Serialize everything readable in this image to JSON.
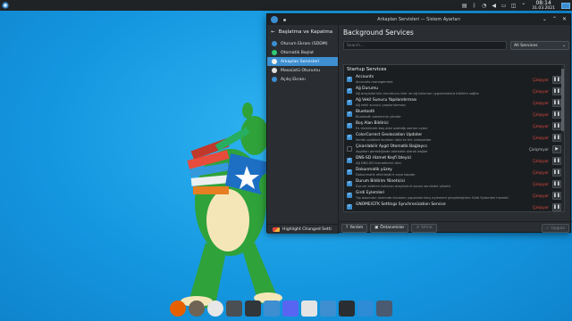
{
  "window": {
    "title": "Arkaplan Servisleri — Sistem Ayarları"
  },
  "sidebar": {
    "header": "Başlatma ve Kapatma",
    "items": [
      {
        "label": "Oturum Ekranı (SDDM)",
        "icon": "login-screen-icon",
        "color": "#3d8fd1"
      },
      {
        "label": "Otomatik Başlat",
        "icon": "autostart-icon",
        "color": "#2ecc71"
      },
      {
        "label": "Arkaplan Servisleri",
        "icon": "background-services-icon",
        "color": "#f0f0f0",
        "active": true
      },
      {
        "label": "Masaüstü Oturumu",
        "icon": "desktop-session-icon",
        "color": "#e0e0e0"
      },
      {
        "label": "Açılış Ekranı",
        "icon": "splash-screen-icon",
        "color": "#3d8fd1"
      }
    ],
    "footer": "Highlight Changed Setti"
  },
  "main": {
    "title": "Background Services",
    "search_placeholder": "Search...",
    "filter": "All Services",
    "section": "Startup Services",
    "services": [
      {
        "name": "Accounts",
        "desc": "Accounts management",
        "checked": true,
        "status": "Çalışıyor",
        "running": true
      },
      {
        "name": "Ağ Durumu",
        "desc": "Ağ arayüzlerinin durumunu izler ve ağ kullanan uygulamalara bildirim sağlar",
        "checked": true,
        "status": "Çalışıyor",
        "running": true
      },
      {
        "name": "Ağ Vekil Sunucu Yapılandırması",
        "desc": "Ağ vekil sunucu yapılandırması",
        "checked": true,
        "status": "Çalışıyor",
        "running": true
      },
      {
        "name": "Bluetooth",
        "desc": "Bluetooth sisteminin yönetir",
        "checked": true,
        "status": "Çalışıyor",
        "running": true
      },
      {
        "name": "Boş Alan Bildirici",
        "desc": "Ev dizininizde boş alan azaldığı zaman uyarır",
        "checked": true,
        "status": "Çalışıyor",
        "running": true
      },
      {
        "name": "ColorCorrect Geolocation Updater",
        "desc": "Sends updated location data to the compositor",
        "checked": true,
        "status": "Çalışıyor",
        "running": true
      },
      {
        "name": "Çıkarılabilir Aygıt Otomatik Bağlayıcı",
        "desc": "Aygıtları gerektiğinde otomatik olarak bağlar",
        "checked": false,
        "status": "Çalışmıyor",
        "running": false
      },
      {
        "name": "DNS-SD Hizmet Keşfi İzleyici",
        "desc": "Ağ DNS-SD hizmetlerini izler",
        "checked": true,
        "status": "Çalışıyor",
        "running": true
      },
      {
        "name": "Dokunmatik yüzey",
        "desc": "Dokunmatik etkinleştirir veya kapatır",
        "checked": true,
        "status": "Çalışıyor",
        "running": true
      },
      {
        "name": "Durum Bildirim Yöneticisi",
        "desc": "Durum bildirim kullanıcı arayüzünü sunan servisleri yönetir",
        "checked": true,
        "status": "Çalışıyor",
        "running": true
      },
      {
        "name": "Girdi Eylemleri",
        "desc": "Tuş basımları üzerinde önceden yapılandırılmış eylemleri gerçekleştiren Girdi Eylemleri hizmeti",
        "checked": true,
        "status": "Çalışıyor",
        "running": true
      },
      {
        "name": "GNOME/GTK Settings Synchronization Service",
        "desc": "",
        "checked": true,
        "status": "Çalışıyor",
        "running": true
      }
    ]
  },
  "footer": {
    "help": "Yardım",
    "defaults": "Öntanımlılar",
    "reset": "Sıfırla",
    "apply": "Uygula"
  },
  "panel": {
    "time": "08:14",
    "date": "31.03.2021"
  },
  "dock": [
    {
      "name": "firefox-icon",
      "color": "#e66000"
    },
    {
      "name": "gimp-icon",
      "color": "#6e6355"
    },
    {
      "name": "webcam-icon",
      "color": "#e8e8e8"
    },
    {
      "name": "disk-icon",
      "color": "#4a4f54"
    },
    {
      "name": "terminal-icon",
      "color": "#31363b"
    },
    {
      "name": "folder-icon",
      "color": "#3d8fd1"
    },
    {
      "name": "discord-icon",
      "color": "#5865f2"
    },
    {
      "name": "game-icon",
      "color": "#e4e4e4"
    },
    {
      "name": "store-icon",
      "color": "#3d8fd1"
    },
    {
      "name": "konsole-icon",
      "color": "#2a2e32"
    },
    {
      "name": "settings-icon",
      "color": "#2e8bd6"
    },
    {
      "name": "toggle-icon",
      "color": "#4a5a70"
    }
  ]
}
